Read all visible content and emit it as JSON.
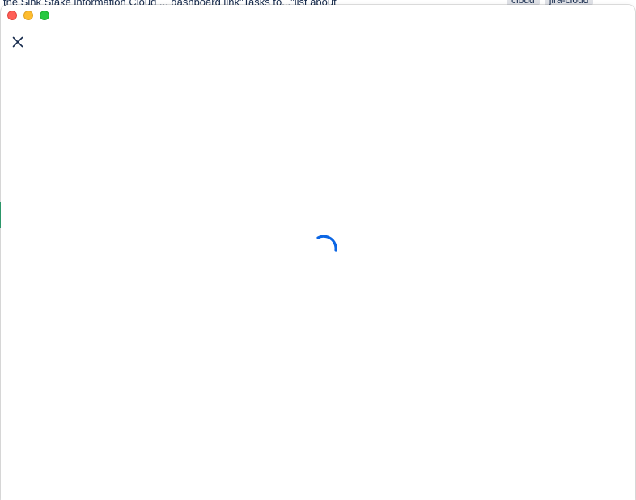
{
  "background": {
    "text": "the Sink Stake information Cloud ... dashboard link\"Tasks to...\"list about",
    "tags": [
      "cloud",
      "jira-cloud"
    ]
  },
  "window": {
    "title": "",
    "controls": {
      "close": "close",
      "minimize": "minimize",
      "zoom": "zoom"
    }
  },
  "modal": {
    "close_icon": "close-icon",
    "loading_icon": "spinner-icon",
    "accent_color": "#0c66e4"
  }
}
